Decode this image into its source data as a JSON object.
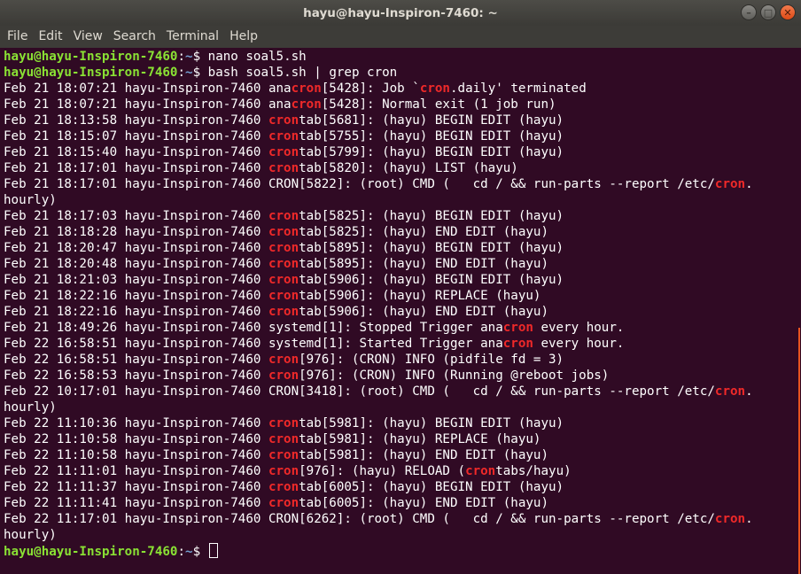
{
  "window": {
    "title": "hayu@hayu-Inspiron-7460: ~",
    "buttons": [
      {
        "name": "minimize-icon",
        "glyph": "–"
      },
      {
        "name": "maximize-icon",
        "glyph": "□"
      },
      {
        "name": "close-icon",
        "glyph": "✕"
      }
    ]
  },
  "menu": [
    "File",
    "Edit",
    "View",
    "Search",
    "Terminal",
    "Help"
  ],
  "colors": {
    "background": "#300a24",
    "prompt_user": "#8ae234",
    "prompt_path": "#729fcf",
    "highlight": "#ef2929",
    "text": "#ffffff"
  },
  "prompt": {
    "user_host": "hayu@hayu-Inspiron-7460",
    "separator": ":",
    "path": "~",
    "symbol": "$ "
  },
  "lines": [
    {
      "type": "prompt",
      "command": "nano soal5.sh"
    },
    {
      "type": "prompt",
      "command": "bash soal5.sh | grep cron"
    },
    {
      "type": "out",
      "segments": [
        "Feb 21 18:07:21 hayu-Inspiron-7460 ana",
        {
          "h": "cron"
        },
        "[5428]: Job `",
        {
          "h": "cron"
        },
        ".daily' terminated"
      ]
    },
    {
      "type": "out",
      "segments": [
        "Feb 21 18:07:21 hayu-Inspiron-7460 ana",
        {
          "h": "cron"
        },
        "[5428]: Normal exit (1 job run)"
      ]
    },
    {
      "type": "out",
      "segments": [
        "Feb 21 18:13:58 hayu-Inspiron-7460 ",
        {
          "h": "cron"
        },
        "tab[5681]: (hayu) BEGIN EDIT (hayu)"
      ]
    },
    {
      "type": "out",
      "segments": [
        "Feb 21 18:15:07 hayu-Inspiron-7460 ",
        {
          "h": "cron"
        },
        "tab[5755]: (hayu) BEGIN EDIT (hayu)"
      ]
    },
    {
      "type": "out",
      "segments": [
        "Feb 21 18:15:40 hayu-Inspiron-7460 ",
        {
          "h": "cron"
        },
        "tab[5799]: (hayu) BEGIN EDIT (hayu)"
      ]
    },
    {
      "type": "out",
      "segments": [
        "Feb 21 18:17:01 hayu-Inspiron-7460 ",
        {
          "h": "cron"
        },
        "tab[5820]: (hayu) LIST (hayu)"
      ]
    },
    {
      "type": "out",
      "segments": [
        "Feb 21 18:17:01 hayu-Inspiron-7460 CRON[5822]: (root) CMD (   cd / && run-parts --report /etc/",
        {
          "h": "cron"
        },
        "."
      ]
    },
    {
      "type": "out",
      "segments": [
        "hourly)"
      ]
    },
    {
      "type": "out",
      "segments": [
        "Feb 21 18:17:03 hayu-Inspiron-7460 ",
        {
          "h": "cron"
        },
        "tab[5825]: (hayu) BEGIN EDIT (hayu)"
      ]
    },
    {
      "type": "out",
      "segments": [
        "Feb 21 18:18:28 hayu-Inspiron-7460 ",
        {
          "h": "cron"
        },
        "tab[5825]: (hayu) END EDIT (hayu)"
      ]
    },
    {
      "type": "out",
      "segments": [
        "Feb 21 18:20:47 hayu-Inspiron-7460 ",
        {
          "h": "cron"
        },
        "tab[5895]: (hayu) BEGIN EDIT (hayu)"
      ]
    },
    {
      "type": "out",
      "segments": [
        "Feb 21 18:20:48 hayu-Inspiron-7460 ",
        {
          "h": "cron"
        },
        "tab[5895]: (hayu) END EDIT (hayu)"
      ]
    },
    {
      "type": "out",
      "segments": [
        "Feb 21 18:21:03 hayu-Inspiron-7460 ",
        {
          "h": "cron"
        },
        "tab[5906]: (hayu) BEGIN EDIT (hayu)"
      ]
    },
    {
      "type": "out",
      "segments": [
        "Feb 21 18:22:16 hayu-Inspiron-7460 ",
        {
          "h": "cron"
        },
        "tab[5906]: (hayu) REPLACE (hayu)"
      ]
    },
    {
      "type": "out",
      "segments": [
        "Feb 21 18:22:16 hayu-Inspiron-7460 ",
        {
          "h": "cron"
        },
        "tab[5906]: (hayu) END EDIT (hayu)"
      ]
    },
    {
      "type": "out",
      "segments": [
        "Feb 21 18:49:26 hayu-Inspiron-7460 systemd[1]: Stopped Trigger ana",
        {
          "h": "cron"
        },
        " every hour."
      ]
    },
    {
      "type": "out",
      "segments": [
        "Feb 22 16:58:51 hayu-Inspiron-7460 systemd[1]: Started Trigger ana",
        {
          "h": "cron"
        },
        " every hour."
      ]
    },
    {
      "type": "out",
      "segments": [
        "Feb 22 16:58:51 hayu-Inspiron-7460 ",
        {
          "h": "cron"
        },
        "[976]: (CRON) INFO (pidfile fd = 3)"
      ]
    },
    {
      "type": "out",
      "segments": [
        "Feb 22 16:58:53 hayu-Inspiron-7460 ",
        {
          "h": "cron"
        },
        "[976]: (CRON) INFO (Running @reboot jobs)"
      ]
    },
    {
      "type": "out",
      "segments": [
        "Feb 22 10:17:01 hayu-Inspiron-7460 CRON[3418]: (root) CMD (   cd / && run-parts --report /etc/",
        {
          "h": "cron"
        },
        "."
      ]
    },
    {
      "type": "out",
      "segments": [
        "hourly)"
      ]
    },
    {
      "type": "out",
      "segments": [
        "Feb 22 11:10:36 hayu-Inspiron-7460 ",
        {
          "h": "cron"
        },
        "tab[5981]: (hayu) BEGIN EDIT (hayu)"
      ]
    },
    {
      "type": "out",
      "segments": [
        "Feb 22 11:10:58 hayu-Inspiron-7460 ",
        {
          "h": "cron"
        },
        "tab[5981]: (hayu) REPLACE (hayu)"
      ]
    },
    {
      "type": "out",
      "segments": [
        "Feb 22 11:10:58 hayu-Inspiron-7460 ",
        {
          "h": "cron"
        },
        "tab[5981]: (hayu) END EDIT (hayu)"
      ]
    },
    {
      "type": "out",
      "segments": [
        "Feb 22 11:11:01 hayu-Inspiron-7460 ",
        {
          "h": "cron"
        },
        "[976]: (hayu) RELOAD (",
        {
          "h": "cron"
        },
        "tabs/hayu)"
      ]
    },
    {
      "type": "out",
      "segments": [
        "Feb 22 11:11:37 hayu-Inspiron-7460 ",
        {
          "h": "cron"
        },
        "tab[6005]: (hayu) BEGIN EDIT (hayu)"
      ]
    },
    {
      "type": "out",
      "segments": [
        "Feb 22 11:11:41 hayu-Inspiron-7460 ",
        {
          "h": "cron"
        },
        "tab[6005]: (hayu) END EDIT (hayu)"
      ]
    },
    {
      "type": "out",
      "segments": [
        "Feb 22 11:17:01 hayu-Inspiron-7460 CRON[6262]: (root) CMD (   cd / && run-parts --report /etc/",
        {
          "h": "cron"
        },
        "."
      ]
    },
    {
      "type": "out",
      "segments": [
        "hourly)"
      ]
    },
    {
      "type": "prompt",
      "command": "",
      "cursor": true
    }
  ]
}
